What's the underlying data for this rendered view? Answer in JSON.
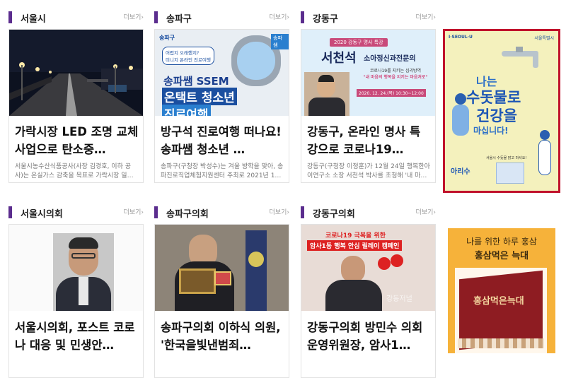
{
  "more_label": "더보기",
  "more_arrow": "›",
  "sections": [
    {
      "title": "서울시",
      "card_title": "가락시장 LED 조명 교체사업으로 탄소중…",
      "card_desc": "서울시농수산식품공사(사장 김경호, 이하 공사)는 온실가스 감축을 목표로 가락시장 일…"
    },
    {
      "title": "송파구",
      "card_title": "방구석 진로여행 떠나요! 송파쌤 청소년 …",
      "card_desc": "송파구(구청장 박성수)는 겨울 방학을 맞아, 송파진로직업체험지원센터 주최로 2021년 1…",
      "thumb": {
        "logo": "송파구",
        "bubble1": "어렵지 오래했지?",
        "bubble2": "미니지 온라인 진로여행",
        "headline1": "송파쌤 SSEM",
        "headline2": "온택트 청소년",
        "headline3": "진로여행",
        "badge": "송파쌤"
      }
    },
    {
      "title": "강동구",
      "card_title": "강동구, 온라인 명사 특강으로 코로나19…",
      "card_desc": "강동구(구청장 이정훈)가 12월 24일 행복한아이연구소 소장 서천석 박사를 초청해 '내 마…",
      "thumb": {
        "top_banner": "2020 강동구 명사 특강",
        "name": "서천석",
        "role": "소아정신과전문의",
        "line1": "코로나19를 지키는 심리방역",
        "line2": "\"내 마음의 행복을 지키는 마음처로\"",
        "date": "2020. 12. 24.(목) 10:30~12:00"
      }
    },
    {
      "title": "서울시의회",
      "card_title": "서울시의회, 포스트 코로나 대응 및 민생안…"
    },
    {
      "title": "송파구의회",
      "card_title": "송파구의회 이하식 의원, '한국을빛낸범죄…"
    },
    {
      "title": "강동구의회",
      "card_title": "강동구의회 방민수 의회운영위원장, 암사1…",
      "thumb": {
        "banner1": "코로나19 극복을 위한",
        "banner2": "암사1동 행복 안심 릴레이 캠페인",
        "watermark": "강동저널"
      }
    }
  ],
  "ad1": {
    "brand": "I·SEOUL·U",
    "org": "서울특별시",
    "line1": "나는",
    "line2": "수돗물로",
    "line3": "건강을",
    "line4": "마십니다!",
    "logo": "아리수",
    "sub": "서울시 수돗물 맑고 마셔요!"
  },
  "ad2": {
    "line1": "나를 위한 하루 홍삼",
    "line2": "홍삼먹은 늑대",
    "product": "홍삼먹은늑대"
  },
  "colors": {
    "accent": "#5b2d8e",
    "ad_border": "#c0122c",
    "ad1_bg": "#f4f1bd",
    "ad2_bg": "#f6b23a"
  }
}
